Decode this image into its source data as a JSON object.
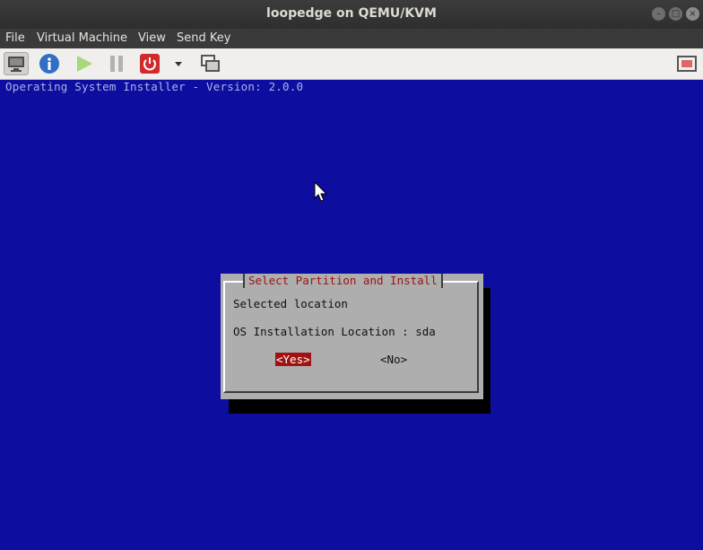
{
  "window": {
    "title": "loopedge on QEMU/KVM"
  },
  "menubar": {
    "items": [
      "File",
      "Virtual Machine",
      "View",
      "Send Key"
    ]
  },
  "toolbar": {
    "buttons": [
      "console-view",
      "details-info",
      "run",
      "pause",
      "shutdown",
      "shutdown-menu",
      "snapshots",
      "fullscreen"
    ],
    "colors": {
      "info": "#2f6fc4",
      "run": "#9fd36a",
      "shutdown": "#d12a2a"
    }
  },
  "console": {
    "background": "#0d0d9f",
    "banner": "Operating System Installer - Version: 2.0.0",
    "dialog": {
      "title": "Select Partition and Install",
      "line1": "Selected location",
      "line2": "OS Installation Location : sda",
      "yes": "<Yes>",
      "no": "<No>"
    }
  }
}
